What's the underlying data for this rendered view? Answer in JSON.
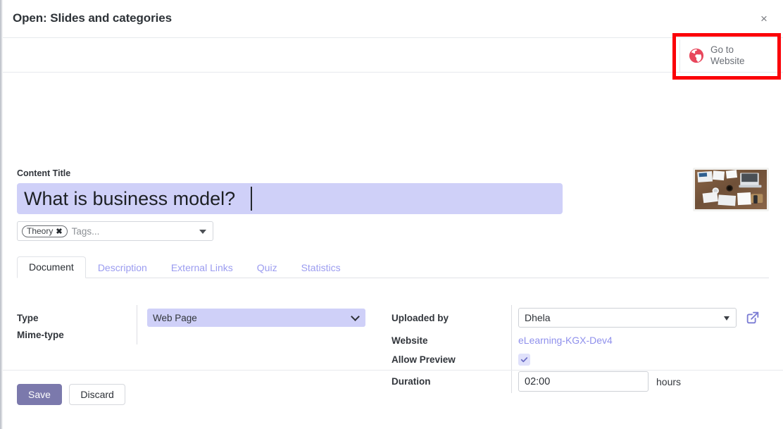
{
  "dialog": {
    "title": "Open: Slides and categories",
    "close_label": "×"
  },
  "toolbar": {
    "go_to_website_label": "Go to\nWebsite",
    "go_to_website_line1": "Go to",
    "go_to_website_line2": "Website",
    "globe_icon": "globe-icon",
    "annotation_color": "#fb0007"
  },
  "content": {
    "content_title_label": "Content Title",
    "content_title_value": "What is business model?",
    "tags": [
      {
        "label": "Theory",
        "remove_label": "✖"
      }
    ],
    "tags_placeholder": "Tags..."
  },
  "tabs": [
    {
      "label": "Document",
      "active": true
    },
    {
      "label": "Description",
      "active": false
    },
    {
      "label": "External Links",
      "active": false
    },
    {
      "label": "Quiz",
      "active": false
    },
    {
      "label": "Statistics",
      "active": false
    }
  ],
  "form": {
    "left": {
      "type_label": "Type",
      "type_value": "Web Page",
      "type_options": [
        "Web Page"
      ],
      "mime_type_label": "Mime-type",
      "mime_type_value": ""
    },
    "right": {
      "uploaded_by_label": "Uploaded by",
      "uploaded_by_value": "Dhela",
      "uploaded_by_options": [
        "Dhela"
      ],
      "open_record_icon": "external-link-icon",
      "website_label": "Website",
      "website_value": "eLearning-KGX-Dev4",
      "allow_preview_label": "Allow Preview",
      "allow_preview_checked": true,
      "duration_label": "Duration",
      "duration_value": "02:00",
      "duration_unit": "hours"
    }
  },
  "footer": {
    "save_label": "Save",
    "discard_label": "Discard",
    "save_color": "#7b79ac"
  }
}
